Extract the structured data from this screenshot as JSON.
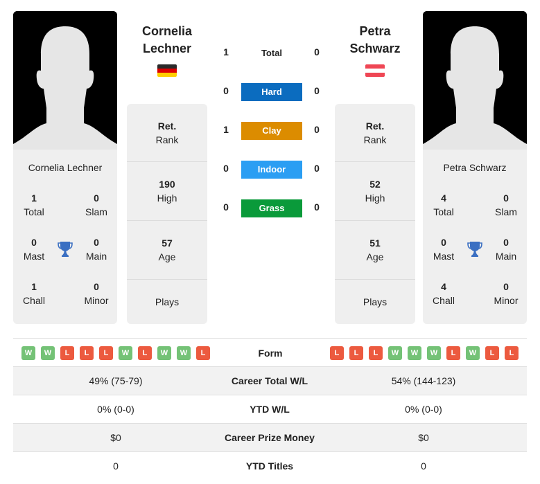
{
  "player1": {
    "name_line1": "Cornelia",
    "name_line2": "Lechner",
    "full_name": "Cornelia Lechner",
    "country_flag": "germany-flag",
    "flag_colors": [
      "#2a2a2a",
      "#dd0000",
      "#ffce00"
    ],
    "titles": {
      "total": {
        "value": "1",
        "label": "Total"
      },
      "slam": {
        "value": "0",
        "label": "Slam"
      },
      "mast": {
        "value": "0",
        "label": "Mast"
      },
      "main": {
        "value": "0",
        "label": "Main"
      },
      "chall": {
        "value": "1",
        "label": "Chall"
      },
      "minor": {
        "value": "0",
        "label": "Minor"
      }
    },
    "info": {
      "rank": {
        "value": "Ret.",
        "label": "Rank"
      },
      "high": {
        "value": "190",
        "label": "High"
      },
      "age": {
        "value": "57",
        "label": "Age"
      },
      "plays": {
        "value": "",
        "label": "Plays"
      }
    },
    "form": [
      "W",
      "W",
      "L",
      "L",
      "L",
      "W",
      "L",
      "W",
      "W",
      "L"
    ]
  },
  "player2": {
    "name_line1": "Petra",
    "name_line2": "Schwarz",
    "full_name": "Petra Schwarz",
    "country_flag": "austria-flag",
    "flag_colors": [
      "#ef4654",
      "#ffffff",
      "#ef4654"
    ],
    "titles": {
      "total": {
        "value": "4",
        "label": "Total"
      },
      "slam": {
        "value": "0",
        "label": "Slam"
      },
      "mast": {
        "value": "0",
        "label": "Mast"
      },
      "main": {
        "value": "0",
        "label": "Main"
      },
      "chall": {
        "value": "4",
        "label": "Chall"
      },
      "minor": {
        "value": "0",
        "label": "Minor"
      }
    },
    "info": {
      "rank": {
        "value": "Ret.",
        "label": "Rank"
      },
      "high": {
        "value": "52",
        "label": "High"
      },
      "age": {
        "value": "51",
        "label": "Age"
      },
      "plays": {
        "value": "",
        "label": "Plays"
      }
    },
    "form": [
      "L",
      "L",
      "L",
      "W",
      "W",
      "W",
      "L",
      "W",
      "L",
      "L"
    ]
  },
  "h2h": {
    "total": {
      "label": "Total",
      "p1": "1",
      "p2": "0"
    },
    "surfaces": [
      {
        "label": "Hard",
        "p1": "0",
        "p2": "0",
        "color": "#0b6cbf"
      },
      {
        "label": "Clay",
        "p1": "1",
        "p2": "0",
        "color": "#dc8c00"
      },
      {
        "label": "Indoor",
        "p1": "0",
        "p2": "0",
        "color": "#2b9ef3"
      },
      {
        "label": "Grass",
        "p1": "0",
        "p2": "0",
        "color": "#0a9a3a"
      }
    ]
  },
  "form_label": "Form",
  "stats_rows": [
    {
      "label": "Career Total W/L",
      "p1": "49% (75-79)",
      "p2": "54% (144-123)"
    },
    {
      "label": "YTD W/L",
      "p1": "0% (0-0)",
      "p2": "0% (0-0)"
    },
    {
      "label": "Career Prize Money",
      "p1": "$0",
      "p2": "$0"
    },
    {
      "label": "YTD Titles",
      "p1": "0",
      "p2": "0"
    }
  ],
  "colors": {
    "win": "#74c276",
    "loss": "#ec5a3f",
    "trophy": "#3a6fc2",
    "card_bg": "#efefef"
  }
}
